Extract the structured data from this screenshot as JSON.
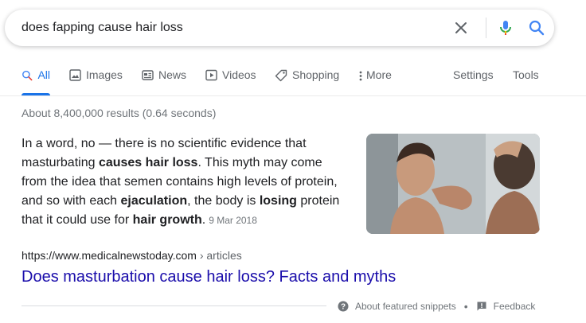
{
  "search": {
    "query": "does fapping cause hair loss"
  },
  "tabs": [
    {
      "label": "All",
      "icon": "search-icon",
      "active": true
    },
    {
      "label": "Images",
      "icon": "image-icon"
    },
    {
      "label": "News",
      "icon": "news-icon"
    },
    {
      "label": "Videos",
      "icon": "video-icon"
    },
    {
      "label": "Shopping",
      "icon": "tag-icon"
    },
    {
      "label": "More",
      "icon": "more-vert-icon"
    }
  ],
  "tools": {
    "settings": "Settings",
    "tools": "Tools"
  },
  "stats": "About 8,400,000 results (0.64 seconds)",
  "snippet": {
    "parts": [
      "In a word, no — there is no scientific evidence that masturbating ",
      "causes hair loss",
      ". This myth may come from the idea that semen contains high levels of protein, and so with each ",
      "ejaculation",
      ", the body is ",
      "losing",
      " protein that it could use for ",
      "hair growth",
      "."
    ],
    "date": "9 Mar 2018",
    "url": "https://www.medicalnewstoday.com",
    "breadcrumb": " › articles",
    "title": "Does masturbation cause hair loss? Facts and myths"
  },
  "footer": {
    "about": "About featured snippets",
    "separator": "•",
    "feedback": "Feedback"
  },
  "colors": {
    "link": "#1a0dab",
    "accent": "#1a73e8",
    "muted": "#70757a"
  }
}
